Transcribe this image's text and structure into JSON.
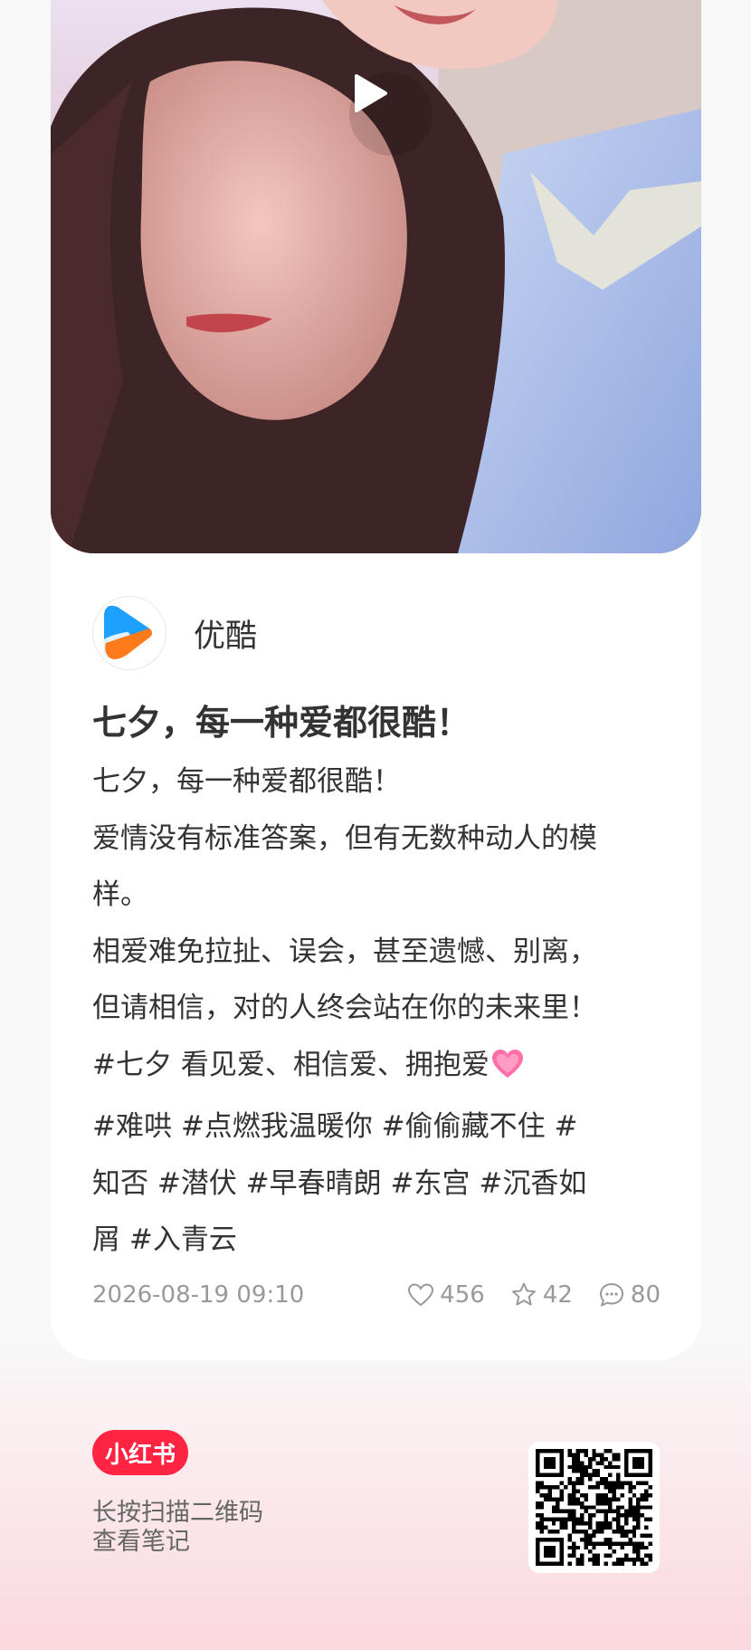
{
  "note": {
    "author": {
      "name": "优酷",
      "avatar_icon": "youku-logo-icon"
    },
    "title": "七夕，每一种爱都很酷！",
    "body_lines": [
      "七夕，每一种爱都很酷！",
      "爱情没有标准答案，但有无数种动人的模",
      "样。",
      "相爱难免拉扯、误会，甚至遗憾、别离，",
      "但请相信，对的人终会站在你的未来里！",
      "#七夕 看见爱、相信爱、拥抱爱",
      "#难哄 #点燃我温暖你 #偷偷藏不住 #",
      "知否 #潜伏 #早春晴朗 #东宫 #沉香如",
      "屑 #入青云"
    ],
    "date": "2026-08-19 09:10",
    "likes": "456",
    "stars": "42",
    "comments": "80"
  },
  "footer": {
    "brand": "小红书",
    "hint_line1": "长按扫描二维码",
    "hint_line2": "查看笔记"
  },
  "colors": {
    "brand": "#ff2442",
    "youku_blue": "#1ea0ff",
    "youku_orange": "#ff7a1a"
  }
}
